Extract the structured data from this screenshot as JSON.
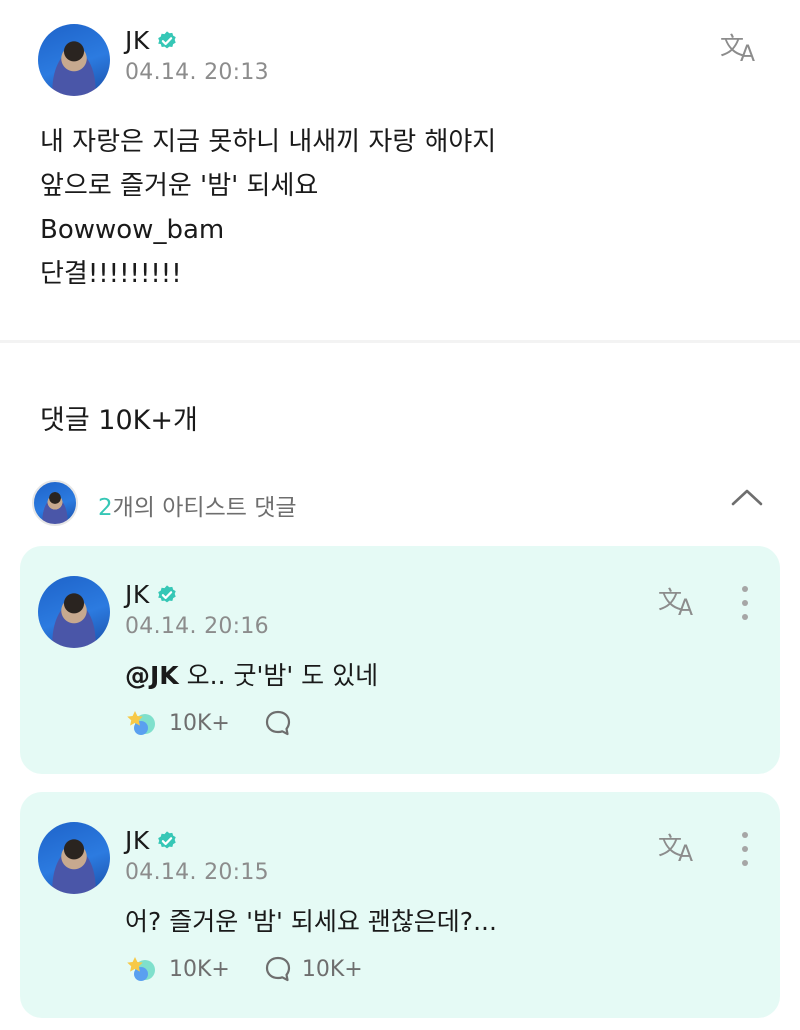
{
  "post": {
    "author": "JK",
    "timestamp": "04.14. 20:13",
    "lines": [
      "내 자랑은 지금 못하니 내새끼 자랑 해야지",
      "앞으로 즐거운 '밤' 되세요",
      "Bowwow_bam",
      "단결!!!!!!!!!"
    ]
  },
  "comments_header": "댓글 10K+개",
  "artist_comments": {
    "count": "2",
    "label": "개의 아티스트 댓글"
  },
  "comments": [
    {
      "author": "JK",
      "timestamp": "04.14. 20:16",
      "mention": "@JK",
      "text": " 오.. 굿'밤' 도 있네",
      "likes": "10K+",
      "replies": ""
    },
    {
      "author": "JK",
      "timestamp": "04.14. 20:15",
      "mention": "",
      "text": "어? 즐거운 '밤' 되세요 괜찮은데?...",
      "likes": "10K+",
      "replies": "10K+"
    }
  ],
  "colors": {
    "accent": "#36c7b6",
    "card_bg": "#e5faf5",
    "muted": "#8c8c8c"
  },
  "icons": [
    "verified-badge-icon",
    "translate-icon",
    "more-icon",
    "chevron-up-icon",
    "like-icon",
    "reply-bubble-icon"
  ]
}
